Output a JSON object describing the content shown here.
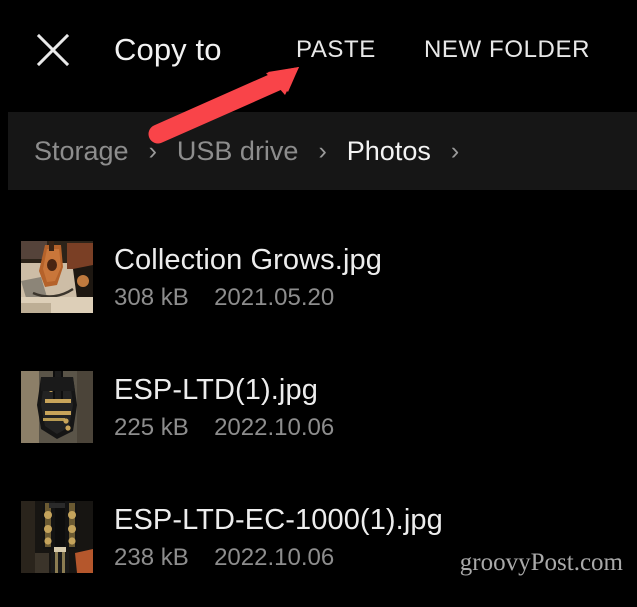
{
  "window": {
    "background_color": "#000000",
    "theme": "dark"
  },
  "header": {
    "close_icon": "close-x-icon",
    "title": "Copy to",
    "actions": [
      {
        "label": "PASTE",
        "name": "paste-button"
      },
      {
        "label": "NEW FOLDER",
        "name": "new-folder-button"
      }
    ]
  },
  "breadcrumb": {
    "separator": "›",
    "bar_color": "#161616",
    "items": [
      {
        "label": "Storage",
        "current": false
      },
      {
        "label": "USB drive",
        "current": false
      },
      {
        "label": "Photos",
        "current": true
      }
    ],
    "trailing_separator": "›"
  },
  "file_list": {
    "files": [
      {
        "name": "Collection Grows.jpg",
        "size": "308 kB",
        "date": "2021.05.20",
        "thumbnail": "acoustic-guitars-photo-thumbnail"
      },
      {
        "name": "ESP-LTD(1).jpg",
        "size": "225 kB",
        "date": "2022.10.06",
        "thumbnail": "black-electric-guitar-photo-thumbnail"
      },
      {
        "name": "ESP-LTD-EC-1000(1).jpg",
        "size": "238 kB",
        "date": "2022.10.06",
        "thumbnail": "guitar-headstock-photo-thumbnail"
      }
    ]
  },
  "annotation": {
    "arrow_color": "#f94449",
    "points_to": "PASTE"
  },
  "watermark": {
    "text": "groovyPost.com"
  }
}
